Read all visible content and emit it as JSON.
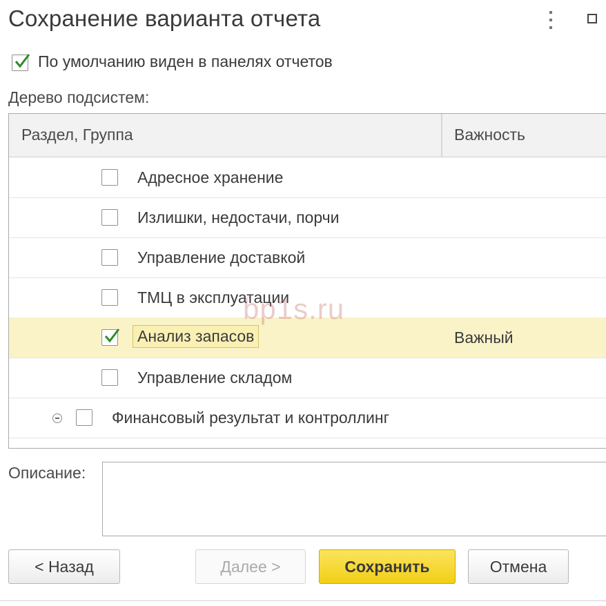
{
  "window": {
    "title": "Сохранение варианта отчета",
    "menu_icon": "vertical-ellipsis-icon",
    "maximize_icon": "maximize-icon"
  },
  "options": {
    "default_visible_label": "По умолчанию виден в панелях отчетов",
    "default_visible_checked": true
  },
  "tree": {
    "label": "Дерево подсистем:",
    "columns": [
      "Раздел, Группа",
      "Важность"
    ],
    "rows": [
      {
        "label": "Адресное хранение",
        "checked": false,
        "importance": ""
      },
      {
        "label": "Излишки, недостачи, порчи",
        "checked": false,
        "importance": ""
      },
      {
        "label": "Управление доставкой",
        "checked": false,
        "importance": ""
      },
      {
        "label": "ТМЦ в эксплуатации",
        "checked": false,
        "importance": ""
      },
      {
        "label": "Анализ запасов",
        "checked": true,
        "importance": "Важный",
        "selected": true
      },
      {
        "label": "Управление складом",
        "checked": false,
        "importance": ""
      },
      {
        "label": "Финансовый результат и контроллинг",
        "checked": false,
        "importance": "",
        "group": true
      }
    ]
  },
  "description": {
    "label": "Описание:",
    "value": ""
  },
  "buttons": {
    "back": "< Назад",
    "next": "Далее >",
    "save": "Сохранить",
    "cancel": "Отмена"
  },
  "watermark": "bp1s.ru",
  "colors": {
    "selected_row": "#faf3c8",
    "primary_button": "#f1cf16",
    "check_mark": "#2e8b2e"
  }
}
